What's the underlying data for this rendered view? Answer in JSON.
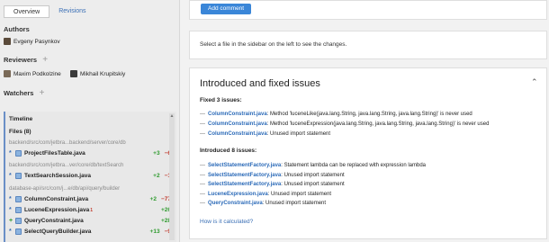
{
  "sidebar": {
    "tabs": [
      "Overview",
      "Revisions"
    ],
    "authors": {
      "title": "Authors",
      "people": [
        "Evgeny Pasynkov"
      ]
    },
    "reviewers": {
      "title": "Reviewers",
      "plus": "+",
      "people": [
        "Maxim Podkolzine",
        "Mikhail Krupitskiy"
      ]
    },
    "watchers": {
      "title": "Watchers",
      "plus": "+"
    },
    "timeline": {
      "title": "Timeline",
      "files_label": "Files (8)"
    },
    "files": [
      {
        "path": "backend/src/com/jetbra...backend/server/core/db"
      },
      {
        "mark": "*",
        "name": "ProjectFilesTable.java",
        "plus": "+3",
        "minus": "−6"
      },
      {
        "path": "backend/src/com/jetbra...ver/core/db/textSearch"
      },
      {
        "mark": "*",
        "name": "TextSearchSession.java",
        "plus": "+2",
        "minus": "−1"
      },
      {
        "path": "database-api/src/com/j...e/db/api/query/builder"
      },
      {
        "mark": "*",
        "name": "ColumnConstraint.java",
        "plus": "+2",
        "minus": "−77"
      },
      {
        "mark": "*",
        "name": "LuceneExpression.java",
        "sup": "1",
        "plus": "+26",
        "minus": ""
      },
      {
        "mark": "+",
        "name": "QueryConstraint.java",
        "plus": "+28",
        "minus": ""
      },
      {
        "mark": "*",
        "name": "SelectQueryBuilder.java",
        "plus": "+13",
        "minus": "−9"
      }
    ]
  },
  "main": {
    "add_comment": "Add comment",
    "hint": "Select a file in the sidebar on the left to see the changes.",
    "issues_title": "Introduced and fixed issues",
    "fixed_title": "Fixed 3 issues:",
    "fixed": [
      {
        "cls": "ColumnConstraint.java",
        "text": ": Method 'luceneLike(java.lang.String, java.lang.String, java.lang.String)' is never used"
      },
      {
        "cls": "ColumnConstraint.java",
        "text": ": Method 'luceneExpression(java.lang.String, java.lang.String, java.lang.String)' is never used"
      },
      {
        "cls": "ColumnConstraint.java",
        "text": ": Unused import statement"
      }
    ],
    "introduced_title": "Introduced 8 issues:",
    "introduced": [
      {
        "cls": "SelectStatementFactory.java",
        "text": ": Statement lambda can be replaced with expression lambda"
      },
      {
        "cls": "SelectStatementFactory.java",
        "text": ": Unused import statement"
      },
      {
        "cls": "SelectStatementFactory.java",
        "text": ": Unused import statement"
      },
      {
        "cls": "LuceneExpression.java",
        "text": ": Unused import statement"
      },
      {
        "cls": "QueryConstraint.java",
        "text": ": Unused import statement"
      }
    ],
    "calc_link": "How is it calculated?"
  }
}
